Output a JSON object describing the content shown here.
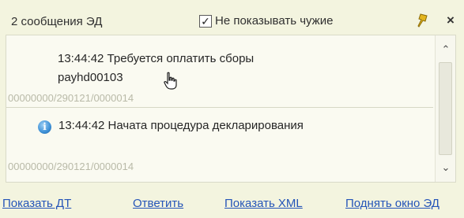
{
  "header": {
    "title": "2 сообщения ЭД",
    "checkbox_label": "Не показывать чужие",
    "checkbox_checked": true,
    "checkbox_mark": "✓",
    "close_glyph": "×",
    "pin_icon": "pin-icon"
  },
  "messages": [
    {
      "time_text": "13:44:42 Требуется оплатить сборы",
      "extra": "payhd00103",
      "id": "00000000/290121/0000014",
      "icon": null
    },
    {
      "time_text": "13:44:42 Начата процедура декларирования",
      "id": "00000000/290121/0000014",
      "icon": "info-icon",
      "icon_glyph": "i"
    }
  ],
  "scrollbar": {
    "up_glyph": "⌃",
    "down_glyph": "⌄"
  },
  "footer": {
    "links": [
      "Показать ДТ",
      "Ответить",
      "Показать XML",
      "Поднять окно ЭД"
    ]
  },
  "colors": {
    "background": "#f3f4df",
    "link": "#2555b8",
    "muted_id": "#b9baa8"
  }
}
